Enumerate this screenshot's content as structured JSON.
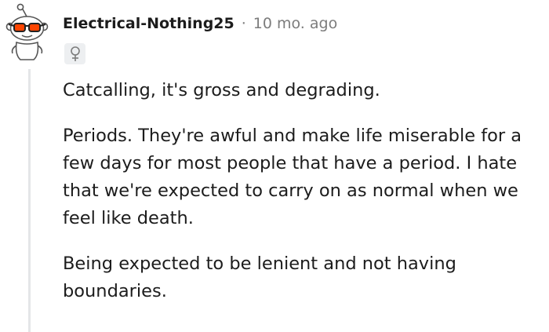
{
  "comment": {
    "author": "Electrical-Nothing25",
    "separator": "·",
    "timestamp": "10 mo. ago",
    "flair_icon": "female-sign-icon",
    "paragraphs": [
      "Catcalling, it's gross and degrading.",
      "Periods. They're awful and make life miserable for a few days for most people that have a period. I hate that we're expected to carry on as normal when we feel like death.",
      "Being expected to be lenient and not having boundaries."
    ]
  },
  "colors": {
    "text": "#1c1c1c",
    "meta": "#7c7c7c",
    "thread_line": "#e4e6e8",
    "avatar_accent": "#ff4500"
  }
}
